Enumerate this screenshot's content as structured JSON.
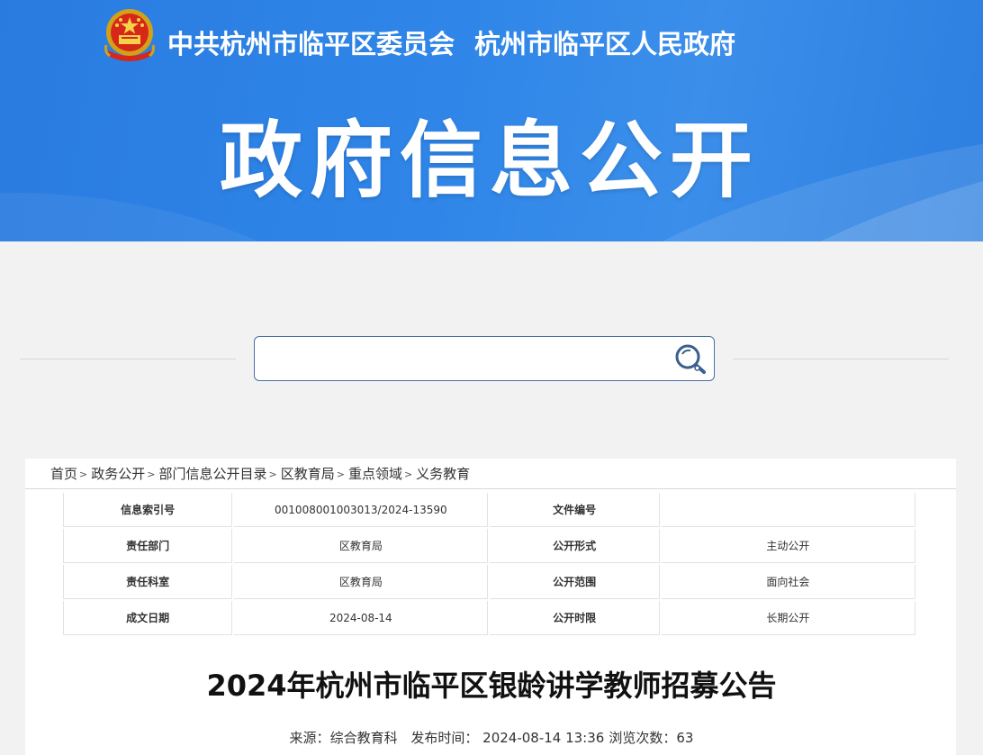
{
  "header": {
    "org_party": "中共杭州市临平区委员会",
    "org_gov": "杭州市临平区人民政府",
    "section_title": "政府信息公开"
  },
  "search": {
    "value": "",
    "placeholder": ""
  },
  "breadcrumb": [
    {
      "label": "首页"
    },
    {
      "label": "政务公开"
    },
    {
      "label": "部门信息公开目录"
    },
    {
      "label": "区教育局"
    },
    {
      "label": "重点领域"
    },
    {
      "label": "义务教育"
    }
  ],
  "breadcrumb_sep": ">",
  "info_table": {
    "rows": [
      {
        "k1": "信息索引号",
        "v1": "001008001003013/2024-13590",
        "k2": "文件编号",
        "v2": ""
      },
      {
        "k1": "责任部门",
        "v1": "区教育局",
        "k2": "公开形式",
        "v2": "主动公开"
      },
      {
        "k1": "责任科室",
        "v1": "区教育局",
        "k2": "公开范围",
        "v2": "面向社会"
      },
      {
        "k1": "成文日期",
        "v1": "2024-08-14",
        "k2": "公开时限",
        "v2": "长期公开"
      }
    ]
  },
  "article": {
    "title": "2024年杭州市临平区银龄讲学教师招募公告",
    "source_label": "来源：",
    "source": "综合教育科",
    "publish_label": "发布时间：",
    "publish_time": "2024-08-14 13:36",
    "views_label": "浏览次数：",
    "views": "63"
  },
  "colors": {
    "banner_blue": "#2f86e8",
    "search_border": "#4a6fa5",
    "page_bg": "#f2f2f2"
  },
  "icons": {
    "emblem": "national-emblem-icon",
    "search": "search-icon"
  }
}
